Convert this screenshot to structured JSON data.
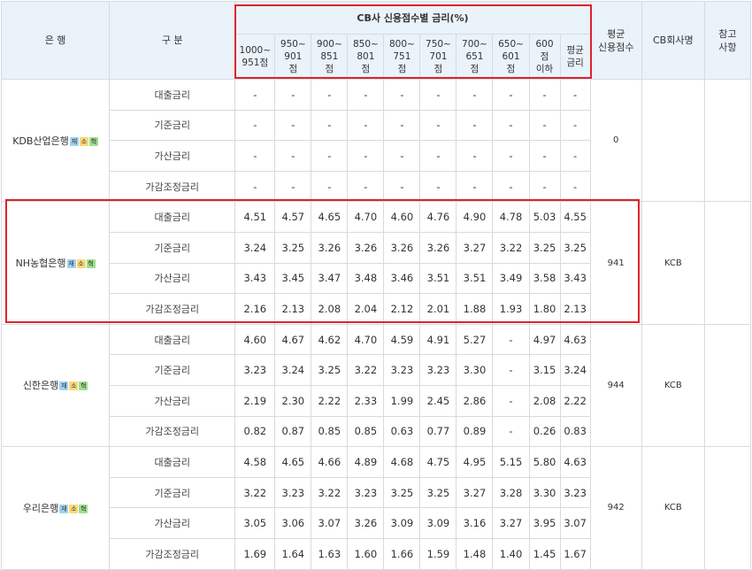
{
  "header": {
    "bank": "은 행",
    "category": "구 분",
    "group": "CB사 신용점수별 금리(%)",
    "score_columns": [
      "1000~\n951점",
      "950~\n901\n점",
      "900~\n851\n점",
      "850~\n801\n점",
      "800~\n751\n점",
      "750~\n701\n점",
      "700~\n651\n점",
      "650~\n601\n점",
      "600\n점\n이하",
      "평균\n금리"
    ],
    "avg_score": "평균\n신용점수",
    "cb_company": "CB회사명",
    "note": "참고\n사항"
  },
  "badge_labels": [
    "재",
    "소",
    "혁"
  ],
  "badge_colors": [
    "#9fd3f2",
    "#ffd878",
    "#9de08a"
  ],
  "highlight_color": "#e0222a",
  "banks": [
    {
      "name": "KDB산업은행",
      "avg_score": "0",
      "cb": "",
      "note": "",
      "rows": [
        {
          "category": "대출금리",
          "values": [
            "-",
            "-",
            "-",
            "-",
            "-",
            "-",
            "-",
            "-",
            "-",
            "-"
          ]
        },
        {
          "category": "기준금리",
          "values": [
            "-",
            "-",
            "-",
            "-",
            "-",
            "-",
            "-",
            "-",
            "-",
            "-"
          ]
        },
        {
          "category": "가산금리",
          "values": [
            "-",
            "-",
            "-",
            "-",
            "-",
            "-",
            "-",
            "-",
            "-",
            "-"
          ]
        },
        {
          "category": "가감조정금리",
          "values": [
            "-",
            "-",
            "-",
            "-",
            "-",
            "-",
            "-",
            "-",
            "-",
            "-"
          ]
        }
      ]
    },
    {
      "name": "NH농협은행",
      "avg_score": "941",
      "cb": "KCB",
      "note": "",
      "rows": [
        {
          "category": "대출금리",
          "values": [
            "4.51",
            "4.57",
            "4.65",
            "4.70",
            "4.60",
            "4.76",
            "4.90",
            "4.78",
            "5.03",
            "4.55"
          ]
        },
        {
          "category": "기준금리",
          "values": [
            "3.24",
            "3.25",
            "3.26",
            "3.26",
            "3.26",
            "3.26",
            "3.27",
            "3.22",
            "3.25",
            "3.25"
          ]
        },
        {
          "category": "가산금리",
          "values": [
            "3.43",
            "3.45",
            "3.47",
            "3.48",
            "3.46",
            "3.51",
            "3.51",
            "3.49",
            "3.58",
            "3.43"
          ]
        },
        {
          "category": "가감조정금리",
          "values": [
            "2.16",
            "2.13",
            "2.08",
            "2.04",
            "2.12",
            "2.01",
            "1.88",
            "1.93",
            "1.80",
            "2.13"
          ]
        }
      ]
    },
    {
      "name": "신한은행",
      "avg_score": "944",
      "cb": "KCB",
      "note": "",
      "rows": [
        {
          "category": "대출금리",
          "values": [
            "4.60",
            "4.67",
            "4.62",
            "4.70",
            "4.59",
            "4.91",
            "5.27",
            "-",
            "4.97",
            "4.63"
          ]
        },
        {
          "category": "기준금리",
          "values": [
            "3.23",
            "3.24",
            "3.25",
            "3.22",
            "3.23",
            "3.23",
            "3.30",
            "-",
            "3.15",
            "3.24"
          ]
        },
        {
          "category": "가산금리",
          "values": [
            "2.19",
            "2.30",
            "2.22",
            "2.33",
            "1.99",
            "2.45",
            "2.86",
            "-",
            "2.08",
            "2.22"
          ]
        },
        {
          "category": "가감조정금리",
          "values": [
            "0.82",
            "0.87",
            "0.85",
            "0.85",
            "0.63",
            "0.77",
            "0.89",
            "-",
            "0.26",
            "0.83"
          ]
        }
      ]
    },
    {
      "name": "우리은행",
      "avg_score": "942",
      "cb": "KCB",
      "note": "",
      "rows": [
        {
          "category": "대출금리",
          "values": [
            "4.58",
            "4.65",
            "4.66",
            "4.89",
            "4.68",
            "4.75",
            "4.95",
            "5.15",
            "5.80",
            "4.63"
          ]
        },
        {
          "category": "기준금리",
          "values": [
            "3.22",
            "3.23",
            "3.22",
            "3.23",
            "3.25",
            "3.25",
            "3.27",
            "3.28",
            "3.30",
            "3.23"
          ]
        },
        {
          "category": "가산금리",
          "values": [
            "3.05",
            "3.06",
            "3.07",
            "3.26",
            "3.09",
            "3.09",
            "3.16",
            "3.27",
            "3.95",
            "3.07"
          ]
        },
        {
          "category": "가감조정금리",
          "values": [
            "1.69",
            "1.64",
            "1.63",
            "1.60",
            "1.66",
            "1.59",
            "1.48",
            "1.40",
            "1.45",
            "1.67"
          ]
        }
      ]
    }
  ]
}
